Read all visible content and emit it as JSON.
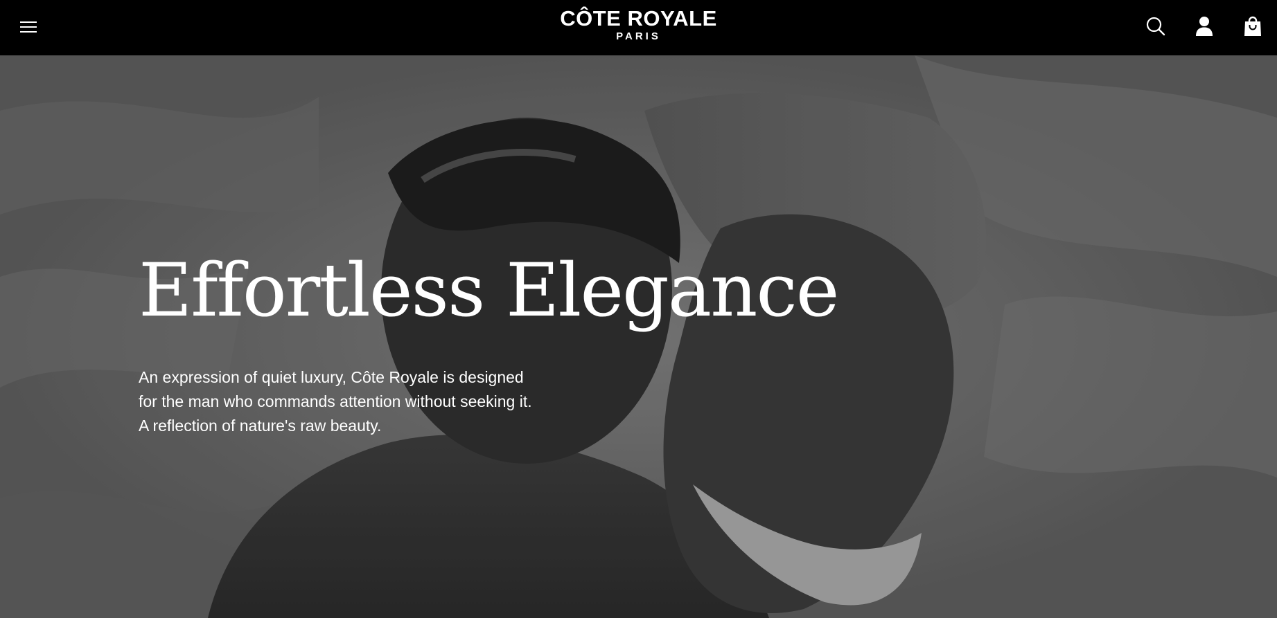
{
  "header": {
    "logo": {
      "main": "CÔTE ROYALE",
      "sub": "PARIS"
    },
    "icons": {
      "menu": "hamburger-menu-icon",
      "search": "search-icon",
      "account": "user-icon",
      "cart": "shopping-bag-icon"
    }
  },
  "hero": {
    "title": "Effortless Elegance",
    "text": "An expression of quiet luxury, Côte Royale is designed for the man who commands attention without seeking it. A reflection of nature's raw beauty.",
    "image": "black and white photo of a couple lying on white bed sheets"
  },
  "colors": {
    "header_bg": "#000000",
    "text": "#ffffff",
    "hero_tone": "#595959"
  }
}
